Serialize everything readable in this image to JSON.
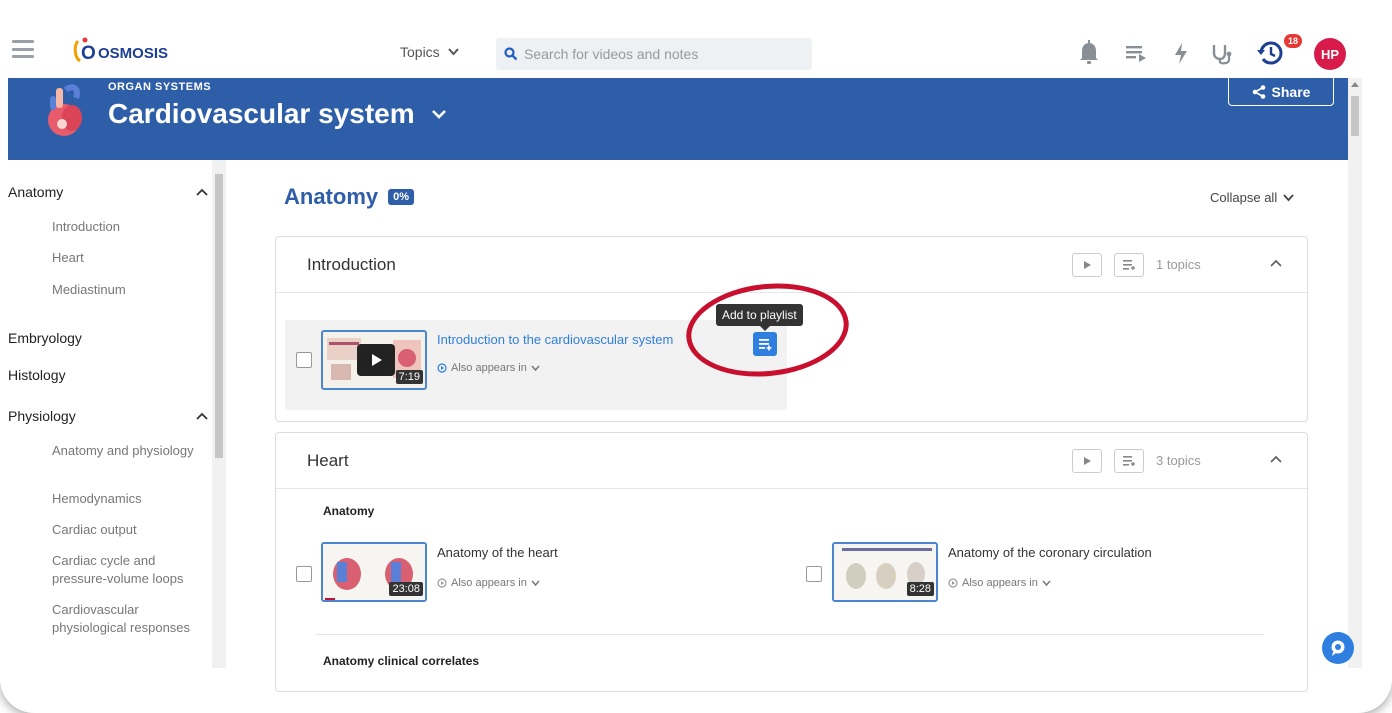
{
  "header": {
    "logo_text": "OSMOSIS",
    "topics_label": "Topics",
    "search_placeholder": "Search for videos and notes",
    "history_badge": "18",
    "avatar_initials": "HP"
  },
  "banner": {
    "eyebrow": "ORGAN SYSTEMS",
    "title": "Cardiovascular system",
    "share_label": "Share"
  },
  "sidebar": {
    "anatomy": "Anatomy",
    "anatomy_items": [
      "Introduction",
      "Heart",
      "Mediastinum"
    ],
    "embryology": "Embryology",
    "histology": "Histology",
    "physiology": "Physiology",
    "physiology_items": [
      "Anatomy and physiology",
      "Hemodynamics",
      "Cardiac output",
      "Cardiac cycle and pressure-volume loops",
      "Cardiovascular physiological responses"
    ]
  },
  "main": {
    "title": "Anatomy",
    "progress": "0%",
    "collapse_all": "Collapse all",
    "cards": [
      {
        "title": "Introduction",
        "topics": "1 topics",
        "videos": [
          {
            "title": "Introduction to the cardiovascular system",
            "duration": "7:19",
            "also": "Also appears in"
          }
        ]
      },
      {
        "title": "Heart",
        "topics": "3 topics",
        "subheading": "Anatomy",
        "videos": [
          {
            "title": "Anatomy of the heart",
            "duration": "23:08",
            "also": "Also appears in"
          },
          {
            "title": "Anatomy of the coronary circulation",
            "duration": "8:28",
            "also": "Also appears in"
          }
        ],
        "subheading2": "Anatomy clinical correlates"
      }
    ]
  },
  "tooltip": "Add to playlist",
  "colors": {
    "brand_blue": "#2f5ea9",
    "accent_blue": "#2f7fe0",
    "annotation_red": "#c8102e",
    "avatar_red": "#d81b4a"
  },
  "icons": [
    "hamburger-icon",
    "search-icon",
    "bell-icon",
    "playlist-icon",
    "flash-icon",
    "stethoscope-icon",
    "history-icon",
    "share-icon",
    "play-icon",
    "playlist-add-icon",
    "chevron-down-icon",
    "chevron-up-icon",
    "chat-icon"
  ]
}
